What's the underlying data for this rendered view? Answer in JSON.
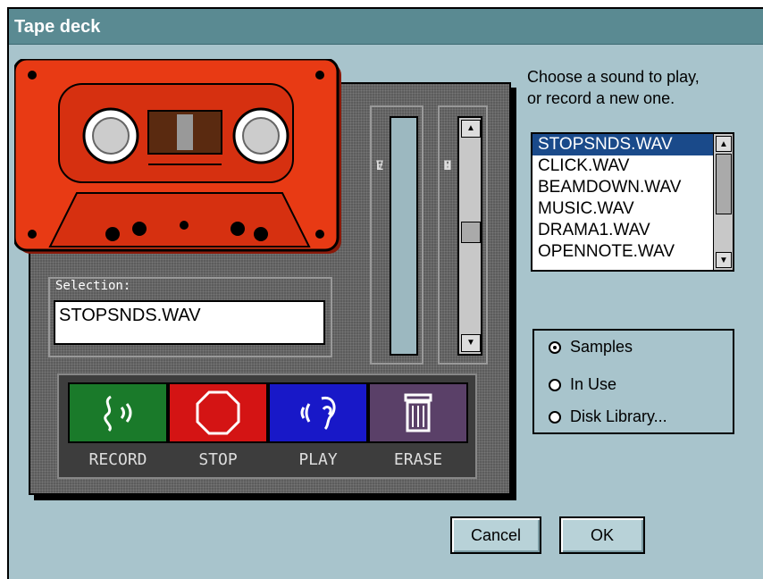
{
  "window": {
    "title": "Tape deck"
  },
  "prompt": {
    "line1": "Choose a sound to play,",
    "line2": "or record a new one."
  },
  "meters": {
    "level_letters": [
      "L",
      "E",
      "V",
      "E",
      "L"
    ],
    "volume_letters": [
      "V",
      "O",
      "L",
      "U",
      "M",
      "E"
    ]
  },
  "selection": {
    "label": "Selection:",
    "value": "STOPSNDS.WAV"
  },
  "transport": [
    {
      "label": "RECORD",
      "icon": "record-icon",
      "color": "#1a7a2a"
    },
    {
      "label": "STOP",
      "icon": "stop-icon",
      "color": "#d41414"
    },
    {
      "label": "PLAY",
      "icon": "play-icon",
      "color": "#1818c8"
    },
    {
      "label": "ERASE",
      "icon": "trash-icon",
      "color": "#5a4068"
    }
  ],
  "sounds": {
    "items": [
      "STOPSNDS.WAV",
      "CLICK.WAV",
      "BEAMDOWN.WAV",
      "MUSIC.WAV",
      "DRAMA1.WAV",
      "OPENNOTE.WAV"
    ],
    "selected": "STOPSNDS.WAV"
  },
  "source": {
    "options": [
      "Samples",
      "In Use",
      "Disk Library..."
    ],
    "selected": "Samples"
  },
  "buttons": {
    "cancel": "Cancel",
    "ok": "OK"
  },
  "colors": {
    "titlebar": "#5a8a92",
    "window": "#a8c4cc",
    "cassette": "#e83a14",
    "list_selection": "#1a4a8a"
  }
}
